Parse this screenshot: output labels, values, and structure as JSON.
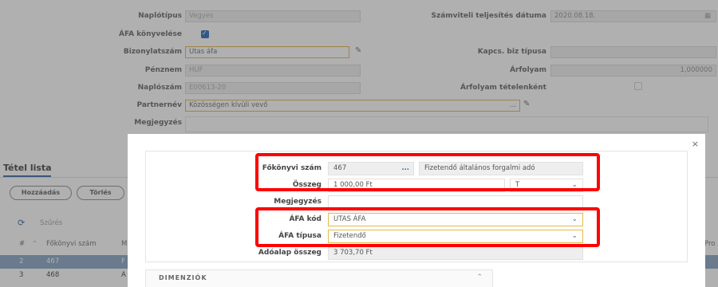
{
  "form": {
    "naplotipus_label": "Naplótípus",
    "naplotipus_value": "Vegyes",
    "afa_konyvelese_label": "ÁFA könyvelése",
    "bizonylatszam_label": "Bizonylatszám",
    "bizonylatszam_value": "Utas áfa",
    "penznem_label": "Pénznem",
    "penznem_value": "HUF",
    "naploszam_label": "Naplószám",
    "naploszam_value": "E00613-20",
    "partnernev_label": "Partnernév",
    "partnernev_value": "Közösségen kívüli vevő",
    "partnernev_dots": "...",
    "megjegyzes_label": "Megjegyzés",
    "szamviteli_label": "Számviteli teljesítés dátuma",
    "szamviteli_value": "2020.08.18.",
    "kapcs_label": "Kapcs. biz típusa",
    "arfolyam_label": "Árfolyam",
    "arfolyam_value": "1,000000",
    "arfolyam_tetel_label": "Árfolyam tételenként"
  },
  "tetel": {
    "title": "Tétel lista",
    "add_button": "Hozzáadás",
    "delete_button": "Törlés",
    "filter_label": "Szűrés",
    "col_hash": "#",
    "col_fokonyvi": "Főkönyvi szám",
    "col_partial_a": "M",
    "col_partial_pro": "Pro",
    "rows": [
      {
        "num": "2",
        "fokonyvi": "467",
        "extra": "F"
      },
      {
        "num": "3",
        "fokonyvi": "468",
        "extra": "A"
      }
    ]
  },
  "modal": {
    "close": "×",
    "fokonyvi_label": "Főkönyvi szám",
    "fokonyvi_value": "467",
    "fokonyvi_dots": "...",
    "fokonyvi_desc": "Fizetendő általános forgalmi adó",
    "osszeg_label": "Összeg",
    "osszeg_value": "1 000,00 Ft",
    "tk_value": "T",
    "megjegyzes_label": "Megjegyzés",
    "afa_kod_label": "ÁFA kód",
    "afa_kod_value": "UTAS ÁFA",
    "afa_tipus_label": "ÁFA típusa",
    "afa_tipus_value": "Fizetendő",
    "adoalap_label": "Adóalap összeg",
    "adoalap_value": "3 703,70 Ft",
    "dimenziok_label": "DIMENZIÓK"
  },
  "colors": {
    "highlight": "#ff0000",
    "checkbox": "#1a5fb0",
    "field_yellow_border": "#e8b84a",
    "selected_row": "#7f9fc0"
  }
}
